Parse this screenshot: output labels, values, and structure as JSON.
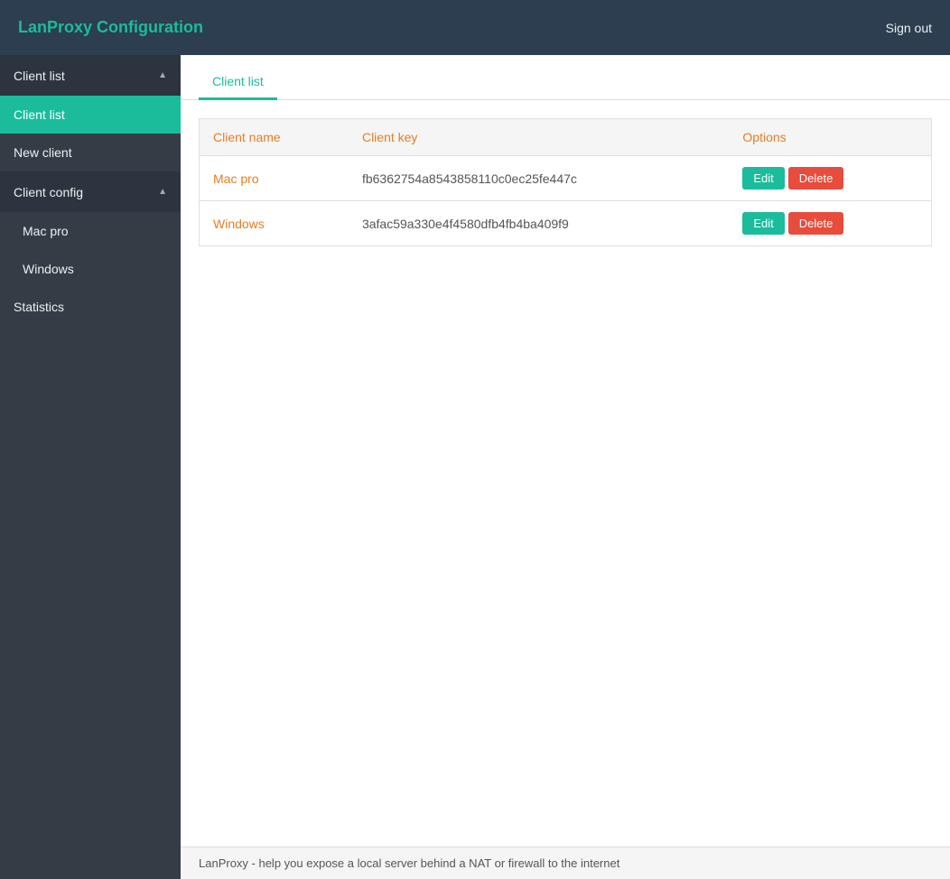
{
  "navbar": {
    "brand": "LanProxy Configuration",
    "signout_label": "Sign out"
  },
  "sidebar": {
    "client_list_header": "Client list",
    "client_list_arrow": "▲",
    "client_list_item": "Client list",
    "new_client_item": "New client",
    "client_config_header": "Client config",
    "client_config_arrow": "▲",
    "mac_pro_item": "Mac pro",
    "windows_item": "Windows",
    "statistics_item": "Statistics"
  },
  "tabs": {
    "client_list_tab": "Client list"
  },
  "table": {
    "col_name": "Client name",
    "col_key": "Client key",
    "col_options": "Options",
    "rows": [
      {
        "name": "Mac pro",
        "key": "fb6362754a8543858110c0ec25fe447c",
        "edit_label": "Edit",
        "delete_label": "Delete"
      },
      {
        "name": "Windows",
        "key": "3afac59a330e4f4580dfb4fb4ba409f9",
        "edit_label": "Edit",
        "delete_label": "Delete"
      }
    ]
  },
  "footer": {
    "text": "LanProxy - help you expose a local server behind a NAT or firewall to the internet"
  }
}
